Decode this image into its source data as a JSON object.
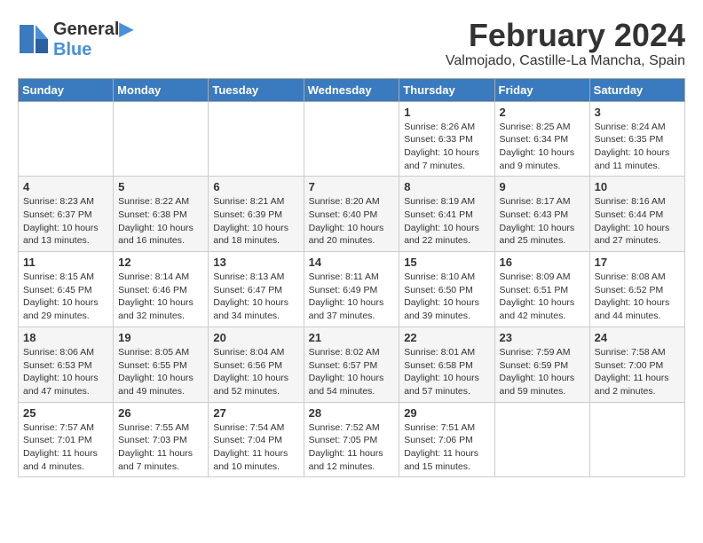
{
  "header": {
    "logo_line1": "General",
    "logo_line2": "Blue",
    "month_year": "February 2024",
    "location": "Valmojado, Castille-La Mancha, Spain"
  },
  "weekdays": [
    "Sunday",
    "Monday",
    "Tuesday",
    "Wednesday",
    "Thursday",
    "Friday",
    "Saturday"
  ],
  "weeks": [
    [
      {
        "day": "",
        "info": ""
      },
      {
        "day": "",
        "info": ""
      },
      {
        "day": "",
        "info": ""
      },
      {
        "day": "",
        "info": ""
      },
      {
        "day": "1",
        "info": "Sunrise: 8:26 AM\nSunset: 6:33 PM\nDaylight: 10 hours\nand 7 minutes."
      },
      {
        "day": "2",
        "info": "Sunrise: 8:25 AM\nSunset: 6:34 PM\nDaylight: 10 hours\nand 9 minutes."
      },
      {
        "day": "3",
        "info": "Sunrise: 8:24 AM\nSunset: 6:35 PM\nDaylight: 10 hours\nand 11 minutes."
      }
    ],
    [
      {
        "day": "4",
        "info": "Sunrise: 8:23 AM\nSunset: 6:37 PM\nDaylight: 10 hours\nand 13 minutes."
      },
      {
        "day": "5",
        "info": "Sunrise: 8:22 AM\nSunset: 6:38 PM\nDaylight: 10 hours\nand 16 minutes."
      },
      {
        "day": "6",
        "info": "Sunrise: 8:21 AM\nSunset: 6:39 PM\nDaylight: 10 hours\nand 18 minutes."
      },
      {
        "day": "7",
        "info": "Sunrise: 8:20 AM\nSunset: 6:40 PM\nDaylight: 10 hours\nand 20 minutes."
      },
      {
        "day": "8",
        "info": "Sunrise: 8:19 AM\nSunset: 6:41 PM\nDaylight: 10 hours\nand 22 minutes."
      },
      {
        "day": "9",
        "info": "Sunrise: 8:17 AM\nSunset: 6:43 PM\nDaylight: 10 hours\nand 25 minutes."
      },
      {
        "day": "10",
        "info": "Sunrise: 8:16 AM\nSunset: 6:44 PM\nDaylight: 10 hours\nand 27 minutes."
      }
    ],
    [
      {
        "day": "11",
        "info": "Sunrise: 8:15 AM\nSunset: 6:45 PM\nDaylight: 10 hours\nand 29 minutes."
      },
      {
        "day": "12",
        "info": "Sunrise: 8:14 AM\nSunset: 6:46 PM\nDaylight: 10 hours\nand 32 minutes."
      },
      {
        "day": "13",
        "info": "Sunrise: 8:13 AM\nSunset: 6:47 PM\nDaylight: 10 hours\nand 34 minutes."
      },
      {
        "day": "14",
        "info": "Sunrise: 8:11 AM\nSunset: 6:49 PM\nDaylight: 10 hours\nand 37 minutes."
      },
      {
        "day": "15",
        "info": "Sunrise: 8:10 AM\nSunset: 6:50 PM\nDaylight: 10 hours\nand 39 minutes."
      },
      {
        "day": "16",
        "info": "Sunrise: 8:09 AM\nSunset: 6:51 PM\nDaylight: 10 hours\nand 42 minutes."
      },
      {
        "day": "17",
        "info": "Sunrise: 8:08 AM\nSunset: 6:52 PM\nDaylight: 10 hours\nand 44 minutes."
      }
    ],
    [
      {
        "day": "18",
        "info": "Sunrise: 8:06 AM\nSunset: 6:53 PM\nDaylight: 10 hours\nand 47 minutes."
      },
      {
        "day": "19",
        "info": "Sunrise: 8:05 AM\nSunset: 6:55 PM\nDaylight: 10 hours\nand 49 minutes."
      },
      {
        "day": "20",
        "info": "Sunrise: 8:04 AM\nSunset: 6:56 PM\nDaylight: 10 hours\nand 52 minutes."
      },
      {
        "day": "21",
        "info": "Sunrise: 8:02 AM\nSunset: 6:57 PM\nDaylight: 10 hours\nand 54 minutes."
      },
      {
        "day": "22",
        "info": "Sunrise: 8:01 AM\nSunset: 6:58 PM\nDaylight: 10 hours\nand 57 minutes."
      },
      {
        "day": "23",
        "info": "Sunrise: 7:59 AM\nSunset: 6:59 PM\nDaylight: 10 hours\nand 59 minutes."
      },
      {
        "day": "24",
        "info": "Sunrise: 7:58 AM\nSunset: 7:00 PM\nDaylight: 11 hours\nand 2 minutes."
      }
    ],
    [
      {
        "day": "25",
        "info": "Sunrise: 7:57 AM\nSunset: 7:01 PM\nDaylight: 11 hours\nand 4 minutes."
      },
      {
        "day": "26",
        "info": "Sunrise: 7:55 AM\nSunset: 7:03 PM\nDaylight: 11 hours\nand 7 minutes."
      },
      {
        "day": "27",
        "info": "Sunrise: 7:54 AM\nSunset: 7:04 PM\nDaylight: 11 hours\nand 10 minutes."
      },
      {
        "day": "28",
        "info": "Sunrise: 7:52 AM\nSunset: 7:05 PM\nDaylight: 11 hours\nand 12 minutes."
      },
      {
        "day": "29",
        "info": "Sunrise: 7:51 AM\nSunset: 7:06 PM\nDaylight: 11 hours\nand 15 minutes."
      },
      {
        "day": "",
        "info": ""
      },
      {
        "day": "",
        "info": ""
      }
    ]
  ]
}
